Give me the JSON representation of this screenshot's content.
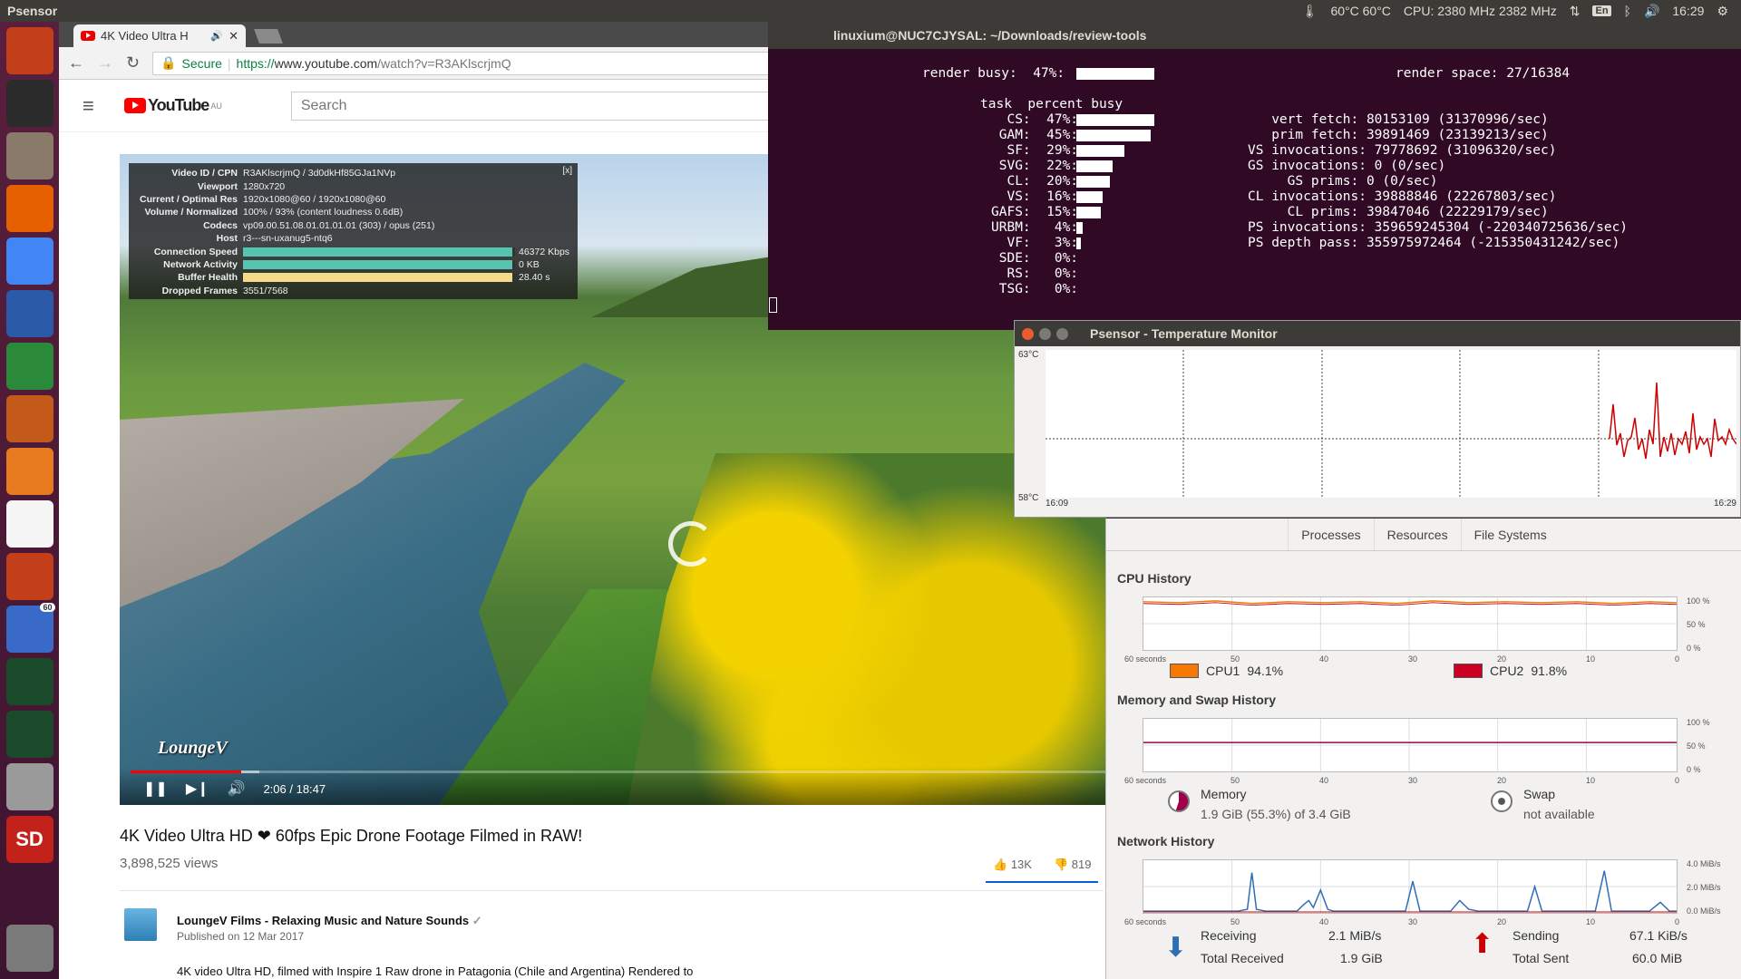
{
  "top_panel": {
    "app_title": "Psensor",
    "temps": "60°C 60°C",
    "cpu": "CPU: 2380 MHz 2382 MHz",
    "lang": "En",
    "clock": "16:29"
  },
  "launcher": {
    "items": [
      {
        "name": "ubuntu-dash",
        "bg": "#c33f1a"
      },
      {
        "name": "terminal",
        "bg": "#2b2b2b"
      },
      {
        "name": "files",
        "bg": "#8a7a6a"
      },
      {
        "name": "firefox",
        "bg": "#e66000"
      },
      {
        "name": "chrome",
        "bg": "#4285f4"
      },
      {
        "name": "writer",
        "bg": "#2a5aa8"
      },
      {
        "name": "calc",
        "bg": "#2a8a3a"
      },
      {
        "name": "impress",
        "bg": "#c35a1a"
      },
      {
        "name": "software",
        "bg": "#e87a20"
      },
      {
        "name": "amazon",
        "bg": "#f5f5f5"
      },
      {
        "name": "settings",
        "bg": "#c33f1a"
      },
      {
        "name": "psensor",
        "bg": "#3a6ac8",
        "badge": "60"
      },
      {
        "name": "system-monitor",
        "bg": "#1a4a2a"
      },
      {
        "name": "system-monitor-2",
        "bg": "#1a4a2a"
      },
      {
        "name": "camera",
        "bg": "#9a9a9a"
      },
      {
        "name": "sd-card",
        "bg": "#c3221a",
        "label": "SD"
      },
      {
        "name": "trash",
        "bg": "#7a7a7a"
      }
    ]
  },
  "browser": {
    "tab_title": "4K Video Ultra H",
    "secure_label": "Secure",
    "url_scheme": "https://",
    "url_host": "www.youtube.com",
    "url_path": "/watch?v=R3AKlscrjmQ",
    "logo_text": "YouTube",
    "logo_region": "AU",
    "search_placeholder": "Search"
  },
  "video": {
    "stats": [
      {
        "k": "Video ID / CPN",
        "v": "R3AKlscrjmQ / 3d0dkHf85GJa1NVp"
      },
      {
        "k": "Viewport",
        "v": "1280x720"
      },
      {
        "k": "Current / Optimal Res",
        "v": "1920x1080@60 / 1920x1080@60"
      },
      {
        "k": "Volume / Normalized",
        "v": "100% / 93% (content loudness 0.6dB)"
      },
      {
        "k": "Codecs",
        "v": "vp09.00.51.08.01.01.01.01 (303) / opus (251)"
      },
      {
        "k": "Host",
        "v": "r3---sn-uxanug5-ntq6"
      }
    ],
    "connection_label": "Connection Speed",
    "connection_value": "46372 Kbps",
    "connection_fill": 0.99,
    "network_label": "Network Activity",
    "network_value": "0 KB",
    "network_fill": 0.99,
    "buffer_label": "Buffer Health",
    "buffer_value": "28.40 s",
    "buffer_fill": 0.99,
    "dropped_label": "Dropped Frames",
    "dropped_value": "3551/7568",
    "close_label": "[x]",
    "watermark": "LoungeV",
    "time": "2:06 / 18:47",
    "played_fraction": 0.112,
    "buffered_fraction": 0.13
  },
  "video_info": {
    "title": "4K Video Ultra HD ❤ 60fps Epic Drone Footage Filmed in RAW!",
    "views": "3,898,525 views",
    "likes": "13K",
    "dislikes": "819",
    "channel": "LoungeV Films - Relaxing Music and Nature Sounds",
    "published": "Published on 12 Mar 2017",
    "description": "4K video Ultra HD, filmed with Inspire 1 Raw drone in Patagonia (Chile and Argentina) Rendered to"
  },
  "terminal": {
    "title": "linuxium@NUC7CJYSAL: ~/Downloads/review-tools",
    "render_busy": "render busy:  47%:",
    "render_space": "render space: 27/16384",
    "header": "task  percent busy",
    "tasks": [
      {
        "label": "  CS:  47%:",
        "value": 47
      },
      {
        "label": " GAM:  45%:",
        "value": 45
      },
      {
        "label": "  SF:  29%:",
        "value": 29
      },
      {
        "label": " SVG:  22%:",
        "value": 22
      },
      {
        "label": "  CL:  20%:",
        "value": 20
      },
      {
        "label": "  VS:  16%:",
        "value": 16
      },
      {
        "label": "GAFS:  15%:",
        "value": 15
      },
      {
        "label": "URBM:   4%:",
        "value": 4
      },
      {
        "label": "  VF:   3%:",
        "value": 3
      },
      {
        "label": " SDE:   0%:",
        "value": 0
      },
      {
        "label": "  RS:   0%:",
        "value": 0
      },
      {
        "label": " TSG:   0%:",
        "value": 0
      }
    ],
    "stats": [
      "   vert fetch: 80153109 (31370996/sec)",
      "   prim fetch: 39891469 (23139213/sec)",
      "VS invocations: 79778692 (31096320/sec)",
      "GS invocations: 0 (0/sec)",
      "     GS prims: 0 (0/sec)",
      "CL invocations: 39888846 (22267803/sec)",
      "     CL prims: 39847046 (22229179/sec)",
      "PS invocations: 359659245304 (-220340725636/sec)",
      "PS depth pass: 355975972464 (-215350431242/sec)"
    ]
  },
  "psensor": {
    "title": "Psensor - Temperature Monitor",
    "y_max": "63°C",
    "y_min": "58°C",
    "x_start": "16:09",
    "x_end": "16:29",
    "line_color": "#cc0000"
  },
  "sysmon": {
    "tabs": [
      "Processes",
      "Resources",
      "File Systems"
    ],
    "cpu_heading": "CPU History",
    "mem_heading": "Memory and Swap History",
    "net_heading": "Network History",
    "x_ticks": [
      "60 seconds",
      "50",
      "40",
      "30",
      "20",
      "10",
      "0"
    ],
    "pct_ticks": [
      "100 %",
      "50 %",
      "0 %"
    ],
    "net_ticks": [
      "4.0 MiB/s",
      "2.0 MiB/s",
      "0.0 MiB/s"
    ],
    "cpu1_label": "CPU1",
    "cpu1_value": "94.1%",
    "cpu1_color": "#f57900",
    "cpu2_label": "CPU2",
    "cpu2_value": "91.8%",
    "cpu2_color": "#cc0022",
    "memory_label": "Memory",
    "memory_value": "1.9 GiB (55.3%) of 3.4 GiB",
    "swap_label": "Swap",
    "swap_value": "not available",
    "receiving_label": "Receiving",
    "receiving_value": "2.1 MiB/s",
    "total_received_label": "Total Received",
    "total_received_value": "1.9 GiB",
    "sending_label": "Sending",
    "sending_value": "67.1 KiB/s",
    "total_sent_label": "Total Sent",
    "total_sent_value": "60.0 MiB"
  }
}
